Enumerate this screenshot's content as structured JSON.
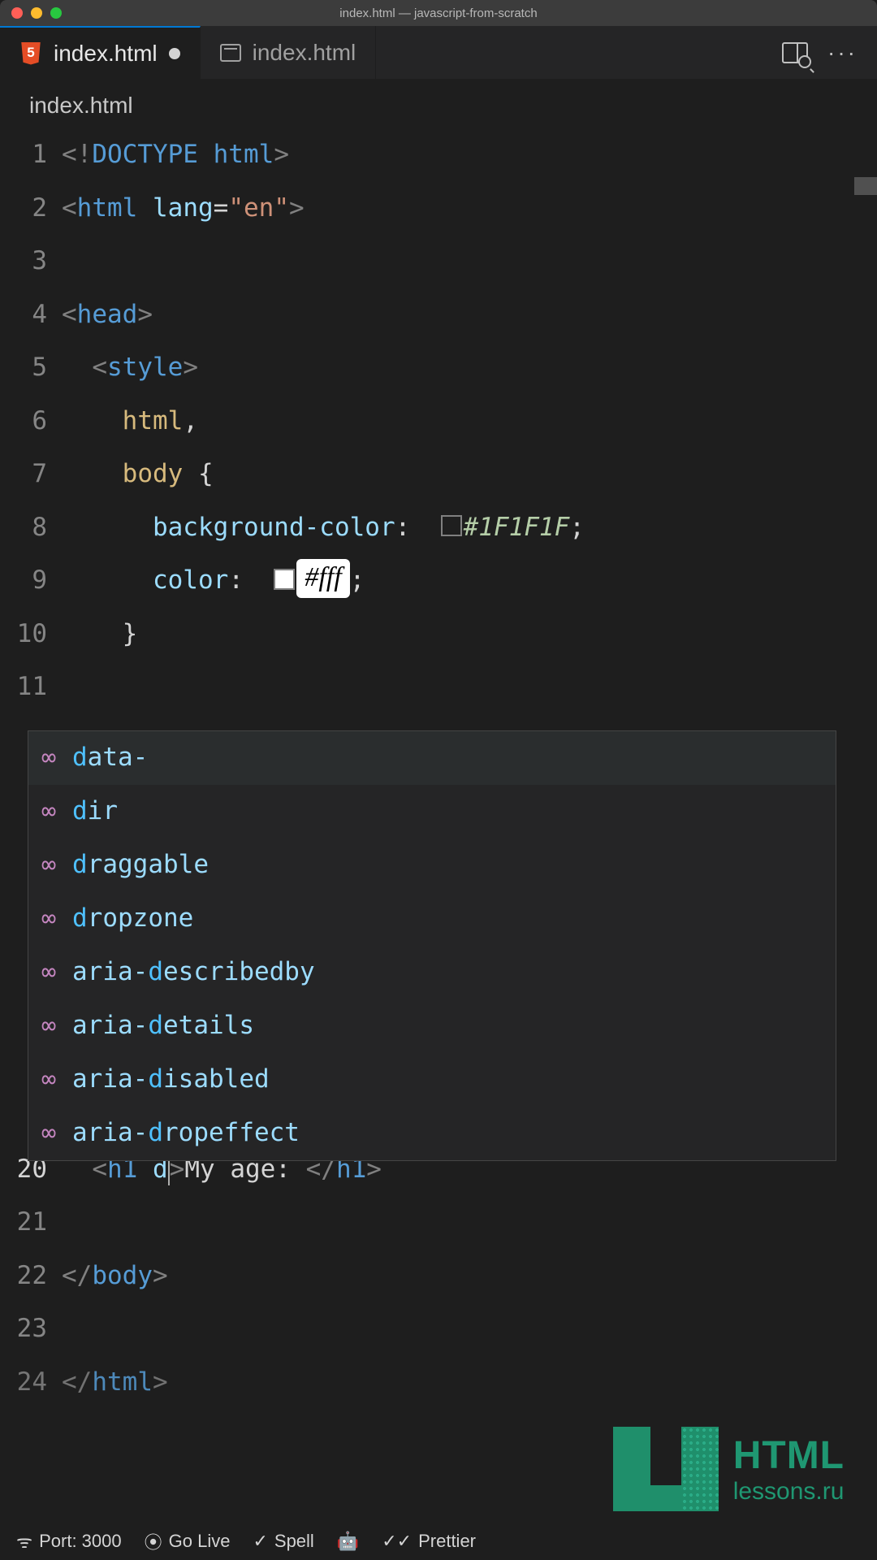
{
  "titlebar": {
    "title": "index.html — javascript-from-scratch"
  },
  "tabs": {
    "active": {
      "label": "index.html"
    },
    "second": {
      "label": "index.html"
    }
  },
  "breadcrumb": "index.html",
  "gutter": [
    "1",
    "2",
    "3",
    "4",
    "5",
    "6",
    "7",
    "8",
    "9",
    "10",
    "11",
    "20",
    "21",
    "22",
    "23",
    "24"
  ],
  "code": {
    "doctype": {
      "open": "<!",
      "kw": "DOCTYPE",
      "rest": " html",
      "close": ">"
    },
    "html_open": {
      "lt": "<",
      "tag": "html",
      "attr": " lang",
      "eq": "=",
      "val": "\"en\"",
      "gt": ">"
    },
    "head_open": {
      "lt": "<",
      "tag": "head",
      "gt": ">"
    },
    "style_open": {
      "lt": "<",
      "tag": "style",
      "gt": ">"
    },
    "sel_html": "html",
    "comma": ",",
    "sel_body": "body",
    "brace_open": " {",
    "bg_prop": "background-color",
    "colon": ":",
    "bg_val": "#1F1F1F",
    "semi": ";",
    "color_prop": "color",
    "color_val": "#fff",
    "brace_close": "}",
    "h1": {
      "lt": "<",
      "tag": "h1",
      "attr_frag": " d",
      "gt_inner": ">",
      "text": "My age: ",
      "close_lt": "</",
      "close_tag": "h1",
      "close_gt": ">"
    },
    "body_close": {
      "lt": "</",
      "tag": "body",
      "gt": ">"
    },
    "html_close": {
      "lt": "</",
      "tag": "html",
      "gt": ">"
    }
  },
  "suggestions": [
    {
      "prefix": "d",
      "rest": "ata-"
    },
    {
      "prefix": "d",
      "rest": "ir"
    },
    {
      "prefix": "d",
      "rest": "raggable"
    },
    {
      "prefix": "d",
      "rest": "ropzone"
    },
    {
      "pre": "aria-",
      "hl": "d",
      "rest": "escribedby"
    },
    {
      "pre": "aria-",
      "hl": "d",
      "rest": "etails"
    },
    {
      "pre": "aria-",
      "hl": "d",
      "rest": "isabled"
    },
    {
      "pre": "aria-",
      "hl": "d",
      "rest": "ropeffect"
    }
  ],
  "watermark": {
    "big": "HTML",
    "small": "lessons.ru"
  },
  "statusbar": {
    "port": "Port: 3000",
    "golive": "Go Live",
    "spell": "Spell",
    "prettier": "Prettier"
  }
}
